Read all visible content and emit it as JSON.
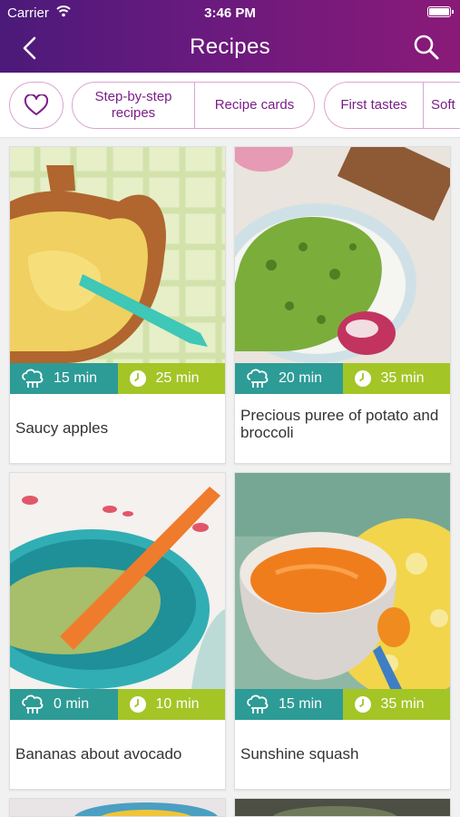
{
  "status_bar": {
    "carrier": "Carrier",
    "time": "3:46 PM"
  },
  "nav": {
    "title": "Recipes"
  },
  "filters": {
    "step_by_step": "Step-by-step\nrecipes",
    "recipe_cards": "Recipe cards",
    "first_tastes": "First tastes",
    "soft": "Soft"
  },
  "recipes": [
    {
      "title": "Saucy apples",
      "prep": "15 min",
      "cook": "25 min"
    },
    {
      "title": "Precious puree of potato and broccoli",
      "prep": "20 min",
      "cook": "35 min"
    },
    {
      "title": "Bananas about avocado",
      "prep": "0 min",
      "cook": "10 min"
    },
    {
      "title": "Sunshine squash",
      "prep": "15 min",
      "cook": "35 min"
    }
  ],
  "colors": {
    "header_start": "#4b1a7a",
    "header_end": "#8a1a78",
    "prep_bg": "#2d9b96",
    "cook_bg": "#a3c526",
    "accent": "#7a1f87"
  }
}
